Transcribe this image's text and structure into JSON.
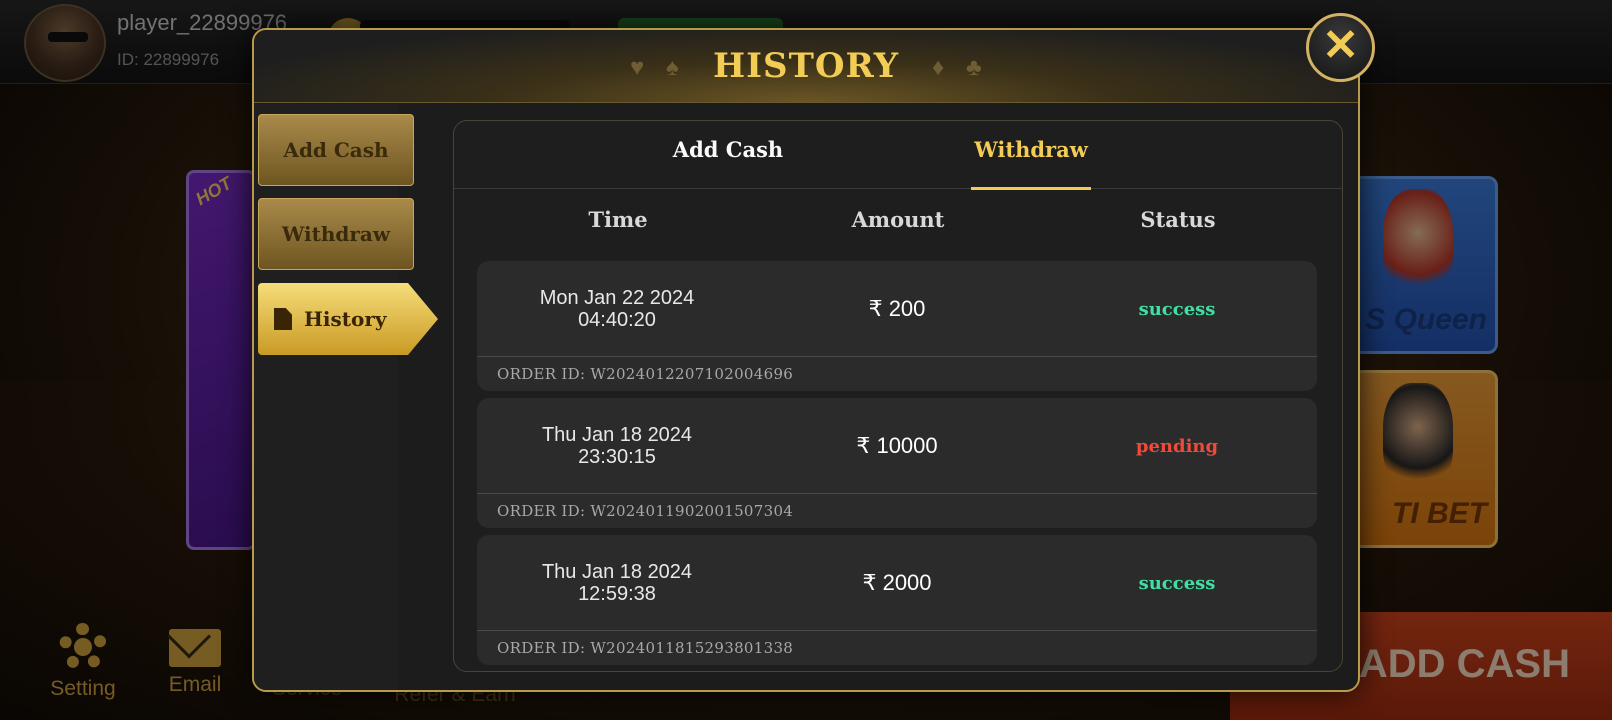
{
  "player": {
    "name": "player_22899976",
    "id_label": "ID: 22899976"
  },
  "background": {
    "promo_badge": "HOT",
    "game_tiles": [
      {
        "label": "S Queen"
      },
      {
        "label": "TI BET"
      }
    ],
    "add_cash_button": "ADD CASH",
    "bottom_nav": [
      {
        "label": "Setting",
        "icon": "gear-icon"
      },
      {
        "label": "Email",
        "icon": "mail-icon"
      },
      {
        "label": "Service",
        "icon": ""
      },
      {
        "label": "Refer & Earn",
        "icon": ""
      }
    ]
  },
  "modal": {
    "title": "HISTORY",
    "suits": [
      "♥",
      "♠",
      "♦",
      "♣"
    ],
    "sidebar": [
      {
        "label": "Add Cash",
        "active": false
      },
      {
        "label": "Withdraw",
        "active": false
      },
      {
        "label": "History",
        "active": true,
        "icon": "document-icon"
      }
    ],
    "tabs": [
      {
        "label": "Add Cash",
        "active": false
      },
      {
        "label": "Withdraw",
        "active": true
      }
    ],
    "columns": [
      "Time",
      "Amount",
      "Status"
    ],
    "records": [
      {
        "date": "Mon Jan 22 2024",
        "time": "04:40:20",
        "amount": "₹ 200",
        "status": "success",
        "order_id": "ORDER ID: W2024012207102004696"
      },
      {
        "date": "Thu Jan 18 2024",
        "time": "23:30:15",
        "amount": "₹ 10000",
        "status": "pending",
        "order_id": "ORDER ID: W2024011902001507304"
      },
      {
        "date": "Thu Jan 18 2024",
        "time": "12:59:38",
        "amount": "₹ 2000",
        "status": "success",
        "order_id": "ORDER ID: W2024011815293801338"
      }
    ],
    "close_icon": "✕"
  },
  "colors": {
    "accent_gold": "#f2cc55",
    "success": "#3fe0a4",
    "pending": "#f24a3a"
  }
}
